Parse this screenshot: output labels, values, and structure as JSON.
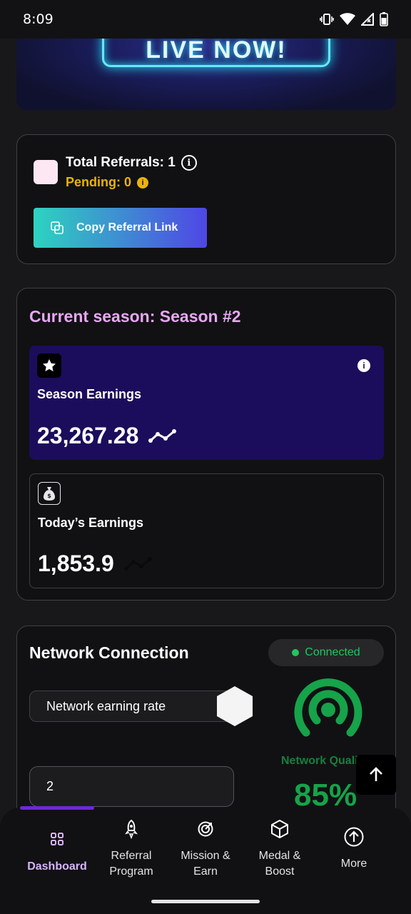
{
  "status_bar": {
    "time": "8:09"
  },
  "banner": {
    "text": "LIVE NOW!"
  },
  "referrals": {
    "total": "Total Referrals: 1",
    "pending": "Pending: 0",
    "copy_button": "Copy Referral Link"
  },
  "season": {
    "title": "Current season: Season #2",
    "season_earnings_label": "Season Earnings",
    "season_earnings_value": "23,267.28",
    "today_earnings_label": "Today’s Earnings",
    "today_earnings_value": "1,853.9"
  },
  "network": {
    "title": "Network Connection",
    "status": "Connected",
    "rate_label": "Network earning rate",
    "input_value": "2",
    "quality_label": "Network Quality",
    "quality_value": "85%"
  },
  "bottom_nav": {
    "items": [
      {
        "label": "Dashboard",
        "icon": "dashboard-icon"
      },
      {
        "label": "Referral\nProgram",
        "icon": "rocket-icon"
      },
      {
        "label": "Mission &\nEarn",
        "icon": "target-icon"
      },
      {
        "label": "Medal &\nBoost",
        "icon": "cube-icon"
      },
      {
        "label": "More",
        "icon": "arrow-up-circle-icon"
      }
    ]
  },
  "colors": {
    "accent_purple": "#d8b4fe",
    "season_title": "#e9a7f5",
    "pending_yellow": "#eab308",
    "connected_green": "#22c55e",
    "season_box": "#1b0d5c"
  }
}
